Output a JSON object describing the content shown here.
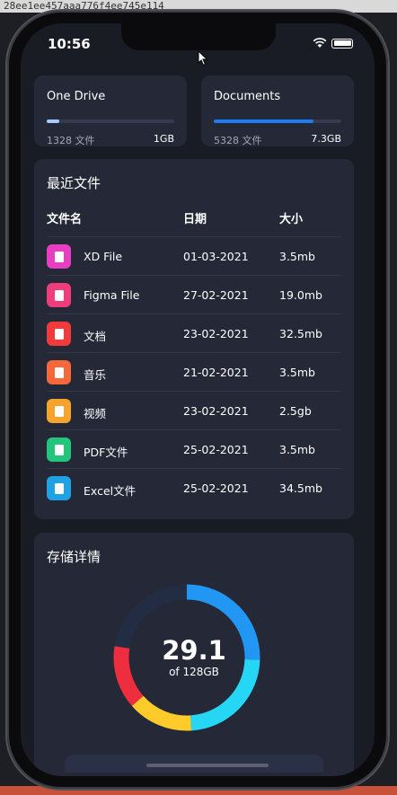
{
  "window": {
    "title": "28ee1ee457aaa776f4ee745e114"
  },
  "status_bar": {
    "time": "10:56"
  },
  "drives": [
    {
      "name": "One Drive",
      "count": "1328 文件",
      "size": "1GB",
      "fill_fraction": 0.1,
      "color": "#a9c9ff"
    },
    {
      "name": "Documents",
      "count": "5328 文件",
      "size": "7.3GB",
      "fill_fraction": 0.78,
      "color": "#1e7cf2"
    }
  ],
  "recent": {
    "title": "最近文件",
    "headers": {
      "name": "文件名",
      "date": "日期",
      "size": "大小"
    },
    "rows": [
      {
        "name": "XD File",
        "date": "01-03-2021",
        "size": "3.5mb",
        "icon": "xd-file-icon",
        "color": "#e83fc2"
      },
      {
        "name": "Figma File",
        "date": "27-02-2021",
        "size": "19.0mb",
        "icon": "figma-file-icon",
        "color": "#ee3d7a"
      },
      {
        "name": "文档",
        "date": "23-02-2021",
        "size": "32.5mb",
        "icon": "document-icon",
        "color": "#ef3b3b"
      },
      {
        "name": "音乐",
        "date": "21-02-2021",
        "size": "3.5mb",
        "icon": "music-icon",
        "color": "#f4683a"
      },
      {
        "name": "视频",
        "date": "23-02-2021",
        "size": "2.5gb",
        "icon": "video-icon",
        "color": "#f5a52e"
      },
      {
        "name": "PDF文件",
        "date": "25-02-2021",
        "size": "3.5mb",
        "icon": "pdf-file-icon",
        "color": "#23c57d"
      },
      {
        "name": "Excel文件",
        "date": "25-02-2021",
        "size": "34.5mb",
        "icon": "excel-file-icon",
        "color": "#1fa1e3"
      }
    ]
  },
  "storage": {
    "title": "存储详情",
    "used": "29.1",
    "total_label": "of 128GB",
    "track_color": "#222c42",
    "segments": [
      {
        "color": "#2196f3",
        "fraction": 0.255
      },
      {
        "color": "#26d7f5",
        "fraction": 0.235
      },
      {
        "color": "#fecb2a",
        "fraction": 0.145
      },
      {
        "color": "#ee2d3f",
        "fraction": 0.14
      }
    ]
  }
}
